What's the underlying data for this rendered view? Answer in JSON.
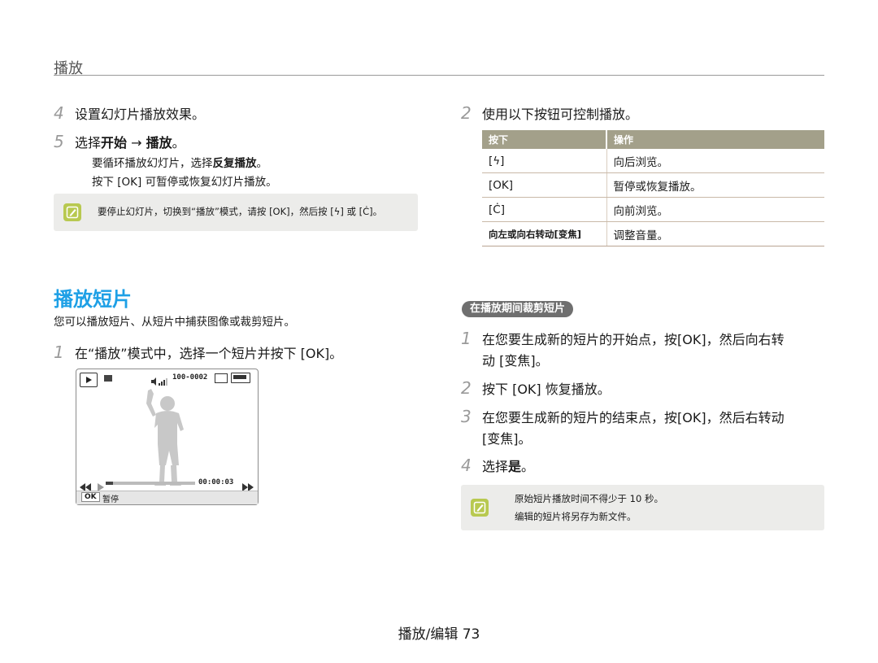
{
  "header": {
    "title": "播放"
  },
  "left_steps": {
    "step4": {
      "num": "4",
      "text": "设置幻灯片播放效果。"
    },
    "step5": {
      "num": "5",
      "pre": "选择",
      "bold1": "开始",
      "arrow": " → ",
      "bold2": "播放",
      "post": "。"
    },
    "sub1": {
      "pre": "要循环播放幻灯片，选择",
      "bold": "反复播放",
      "post": "。"
    },
    "sub2": "按下 [OK] 可暂停或恢复幻灯片播放。"
  },
  "note1": {
    "text": "要停止幻灯片，切换到“播放”模式，请按 [OK]，然后按 [ϟ] 或 [Ċ]。"
  },
  "section": {
    "title": "播放短片",
    "desc": "您可以播放短片、从短片中捕获图像或裁剪短片。",
    "step1": {
      "num": "1",
      "text": "在“播放”模式中，选择一个短片并按下 [OK]。"
    }
  },
  "camera": {
    "file_no": "100-0002",
    "time": "00:00:03",
    "ok_label": "OK",
    "pause_label": "暂停"
  },
  "right_steps": {
    "step2": {
      "num": "2",
      "text": "使用以下按钮可控制播放。"
    }
  },
  "table": {
    "headers": [
      "按下",
      "操作"
    ],
    "rows": [
      {
        "key": "[ϟ]",
        "action": "向后浏览。"
      },
      {
        "key": "[OK]",
        "action": "暂停或恢复播放。"
      },
      {
        "key": "[Ċ]",
        "action": "向前浏览。"
      },
      {
        "key": "向左或向右转动[变焦]",
        "action": "调整音量。"
      }
    ]
  },
  "trim": {
    "pill": "在播放期间裁剪短片",
    "step1": {
      "num": "1",
      "line1": "在您要生成新的短片的开始点，按[OK]，然后向右转",
      "line2": "动 [变焦]。"
    },
    "step2": {
      "num": "2",
      "text": "按下 [OK] 恢复播放。"
    },
    "step3": {
      "num": "3",
      "line1": "在您要生成新的短片的结束点，按[OK]，然后右转动",
      "line2": "[变焦]。"
    },
    "step4": {
      "num": "4",
      "pre": "选择",
      "bold": "是",
      "post": "。"
    }
  },
  "note2": {
    "line1": "原始短片播放时间不得少于 10 秒。",
    "line2": "编辑的短片将另存为新文件。"
  },
  "footer": {
    "text": "播放/编辑 73"
  },
  "colors": {
    "section_title": "#1ea0e6",
    "table_header": "#a3a08a",
    "note_icon": "#b8c950"
  }
}
